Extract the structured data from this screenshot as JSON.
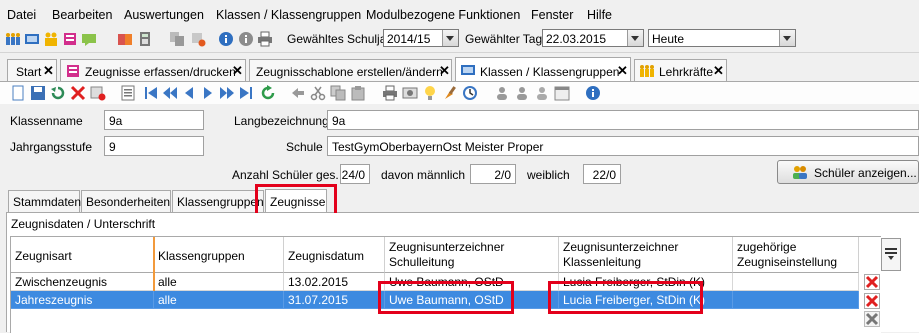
{
  "menu": [
    "Datei",
    "Bearbeiten",
    "Auswertungen",
    "Klassen / Klassengruppen",
    "Modulbezogene Funktionen",
    "Fenster",
    "Hilfe"
  ],
  "toolbar": {
    "schuljahr_label": "Gewähltes Schuljahr",
    "schuljahr_value": "2014/15",
    "tag_label": "Gewählter Tag",
    "tag_value": "22.03.2015",
    "heute_value": "Heute"
  },
  "tabs": [
    {
      "label": "Start"
    },
    {
      "label": "Zeugnisse erfassen/drucken"
    },
    {
      "label": "Zeugnisschablone erstellen/ändern"
    },
    {
      "label": "Klassen / Klassengruppen"
    },
    {
      "label": "Lehrkräfte"
    }
  ],
  "form": {
    "klassenname_label": "Klassenname",
    "klassenname_value": "9a",
    "langbezeichnung_label": "Langbezeichnung",
    "langbezeichnung_value": "9a",
    "jahrgangsstufe_label": "Jahrgangsstufe",
    "jahrgangsstufe_value": "9",
    "schule_label": "Schule",
    "schule_value": "TestGymOberbayernOst Meister Proper",
    "anzahl_label": "Anzahl Schüler ges.",
    "anzahl_value": "24/0",
    "maennlich_label": "davon männlich",
    "maennlich_value": "2/0",
    "weiblich_label": "weiblich",
    "weiblich_value": "22/0",
    "schueler_button": "Schüler anzeigen..."
  },
  "inner_tabs": [
    "Stammdaten",
    "Besonderheiten",
    "Klassengruppen",
    "Zeugnisse"
  ],
  "group_title": "Zeugnisdaten / Unterschrift",
  "grid": {
    "headers": [
      "Zeugnisart",
      "Klassengruppen",
      "Zeugnisdatum",
      "Zeugnisunterzeichner\nSchulleitung",
      "Zeugnisunterzeichner\nKlassenleitung",
      "zugehörige\nZeugniseinstellung"
    ],
    "rows": [
      {
        "art": "Zwischenzeugnis",
        "gruppe": "alle",
        "datum": "13.02.2015",
        "schulleitung": "Uwe Baumann, OStD",
        "klassenleitung": "Lucia Freiberger, StDin (K)",
        "einstellung": ""
      },
      {
        "art": "Jahreszeugnis",
        "gruppe": "alle",
        "datum": "31.07.2015",
        "schulleitung": "Uwe Baumann, OStD",
        "klassenleitung": "Lucia Freiberger, StDin (K)",
        "einstellung": ""
      }
    ]
  },
  "colors": {
    "selection": "#3d8ae0",
    "highlight_box": "#e3001b",
    "accent_orange": "#f29a3c"
  }
}
